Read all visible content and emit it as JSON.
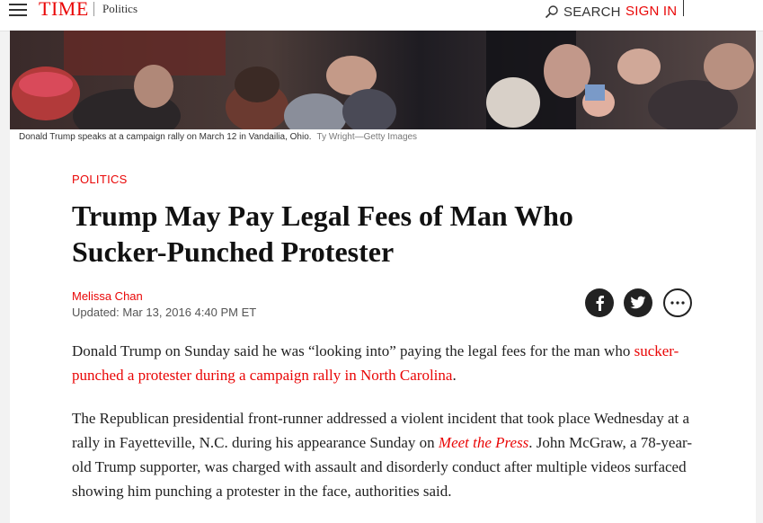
{
  "header": {
    "logo": "TIME",
    "section": "Politics",
    "search_label": "SEARCH",
    "signin_label": "SIGN IN",
    "brand_color": "#e90606"
  },
  "hero": {
    "caption": "Donald Trump speaks at a campaign rally on March 12 in Vandailia, Ohio.",
    "credit": "Ty Wright—Getty Images"
  },
  "article": {
    "kicker": "POLITICS",
    "headline_line1": "Trump May Pay Legal Fees of Man Who",
    "headline_line2": "Sucker-Punched Protester",
    "author": "Melissa Chan",
    "updated": "Updated: Mar 13, 2016 4:40 PM ET",
    "share": {
      "facebook_icon": "f",
      "twitter_icon": "twitter-bird-icon",
      "more_icon": "more-dots-icon"
    },
    "p1_text_a": "Donald Trump on Sunday said he was “looking into” paying the legal fees for the man who ",
    "p1_link": "sucker-punched a protester during a campaign rally in North Carolina",
    "p1_text_b": ".",
    "p2_text_a": "The Republican presidential front-runner addressed a violent incident that took place Wednesday at a rally in Fayetteville, N.C. during his appearance Sunday on ",
    "p2_link": "Meet the Press",
    "p2_text_b": ". John McGraw, a 78-year-old Trump supporter, was charged with assault and disorderly conduct after multiple videos surfaced showing him punching a protester in the face, authorities said."
  }
}
